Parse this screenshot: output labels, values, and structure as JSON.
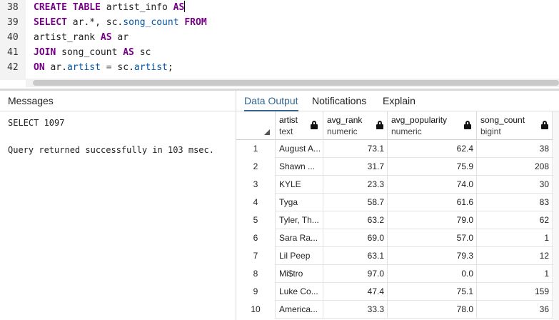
{
  "editor": {
    "lines": [
      {
        "num": "38",
        "tokens": [
          [
            "kw",
            "CREATE TABLE"
          ],
          [
            "plain",
            " artist_info "
          ],
          [
            "kw",
            "AS"
          ]
        ]
      },
      {
        "num": "39",
        "tokens": [
          [
            "kw",
            "SELECT"
          ],
          [
            "plain",
            " ar.*, sc."
          ],
          [
            "prop",
            "song_count"
          ],
          [
            "plain",
            " "
          ],
          [
            "kw",
            "FROM"
          ]
        ]
      },
      {
        "num": "40",
        "tokens": [
          [
            "plain",
            "artist_rank "
          ],
          [
            "kw",
            "AS"
          ],
          [
            "plain",
            " ar"
          ]
        ]
      },
      {
        "num": "41",
        "tokens": [
          [
            "kw",
            "JOIN"
          ],
          [
            "plain",
            " song_count "
          ],
          [
            "kw",
            "AS"
          ],
          [
            "plain",
            " sc"
          ]
        ]
      },
      {
        "num": "42",
        "tokens": [
          [
            "kw",
            "ON"
          ],
          [
            "plain",
            " ar."
          ],
          [
            "prop",
            "artist"
          ],
          [
            "plain",
            " "
          ],
          [
            "op",
            "="
          ],
          [
            "plain",
            " sc."
          ],
          [
            "prop",
            "artist"
          ],
          [
            "plain",
            ";"
          ]
        ]
      }
    ]
  },
  "messages": {
    "header": "Messages",
    "line1": "SELECT 1097",
    "line2": "Query returned successfully in 103 msec."
  },
  "tabs": [
    {
      "label": "Data Output",
      "active": true
    },
    {
      "label": "Notifications",
      "active": false
    },
    {
      "label": "Explain",
      "active": false
    }
  ],
  "grid": {
    "columns": [
      {
        "name": "artist",
        "type": "text"
      },
      {
        "name": "avg_rank",
        "type": "numeric"
      },
      {
        "name": "avg_popularity",
        "type": "numeric"
      },
      {
        "name": "song_count",
        "type": "bigint"
      }
    ],
    "rows": [
      {
        "n": "1",
        "artist": "August A...",
        "avg_rank": "73.1",
        "avg_popularity": "62.4",
        "song_count": "38"
      },
      {
        "n": "2",
        "artist": "Shawn ...",
        "avg_rank": "31.7",
        "avg_popularity": "75.9",
        "song_count": "208"
      },
      {
        "n": "3",
        "artist": "KYLE",
        "avg_rank": "23.3",
        "avg_popularity": "74.0",
        "song_count": "30"
      },
      {
        "n": "4",
        "artist": "Tyga",
        "avg_rank": "58.7",
        "avg_popularity": "61.6",
        "song_count": "83"
      },
      {
        "n": "5",
        "artist": "Tyler, Th...",
        "avg_rank": "63.2",
        "avg_popularity": "79.0",
        "song_count": "62"
      },
      {
        "n": "6",
        "artist": "Sara Ra...",
        "avg_rank": "69.0",
        "avg_popularity": "57.0",
        "song_count": "1"
      },
      {
        "n": "7",
        "artist": "Lil Peep",
        "avg_rank": "63.1",
        "avg_popularity": "79.3",
        "song_count": "12"
      },
      {
        "n": "8",
        "artist": "Mi$tro",
        "avg_rank": "97.0",
        "avg_popularity": "0.0",
        "song_count": "1"
      },
      {
        "n": "9",
        "artist": "Luke Co...",
        "avg_rank": "47.4",
        "avg_popularity": "75.1",
        "song_count": "159"
      },
      {
        "n": "10",
        "artist": "America...",
        "avg_rank": "33.3",
        "avg_popularity": "78.0",
        "song_count": "36"
      }
    ]
  }
}
